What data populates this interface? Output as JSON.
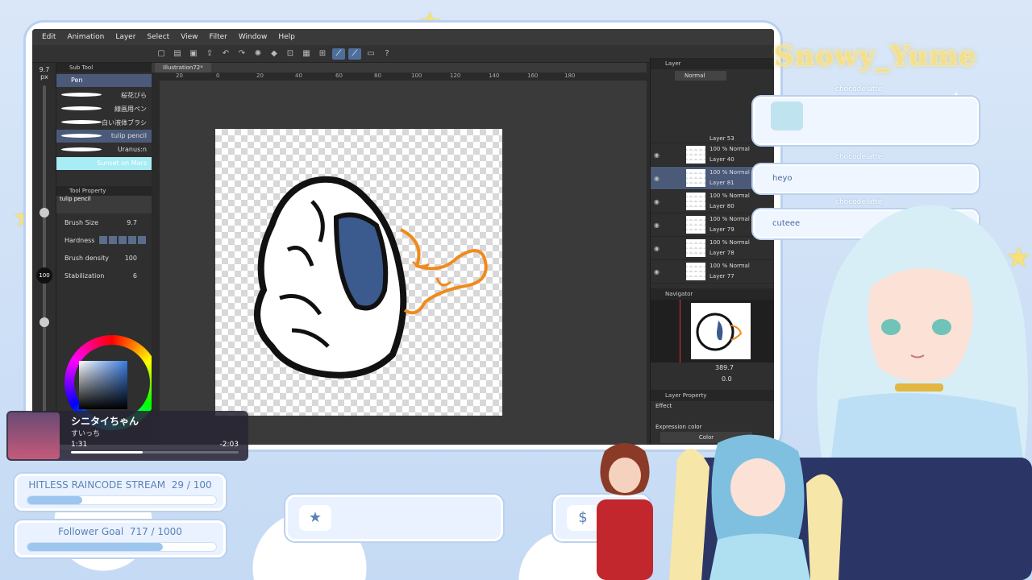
{
  "menu": [
    "Edit",
    "Animation",
    "Layer",
    "Select",
    "View",
    "Filter",
    "Window",
    "Help"
  ],
  "left_strip": {
    "brush_size_display": "9.7",
    "brush_unit": "px",
    "opacity": "100"
  },
  "subtool": {
    "header": "Sub Tool",
    "pen_label": "Pen",
    "brushes": [
      "桜花びら",
      "線画用ペン",
      "白い液体ブラシ",
      "tulip pencil",
      "Uranus:n",
      "Sunset on Mars"
    ],
    "tool_property_header": "Tool Property",
    "tool_name": "tulip pencil",
    "brush_size_label": "Brush Size",
    "brush_size_value": "9.7",
    "hardness_label": "Hardness",
    "density_label": "Brush density",
    "density_value": "100",
    "stabilization_label": "Stabilization",
    "stabilization_value": "6"
  },
  "document": {
    "tab": "Illustration72*",
    "ruler_ticks": [
      "20",
      "0",
      "20",
      "40",
      "60",
      "80",
      "100",
      "120",
      "140",
      "160",
      "180"
    ]
  },
  "layer_panel": {
    "header": "Layer",
    "blend_mode": "Normal",
    "layers": [
      {
        "opacity": "",
        "name": "Layer 53"
      },
      {
        "opacity": "100 % Normal",
        "name": "Layer 40"
      },
      {
        "opacity": "100 % Normal",
        "name": "Layer 81",
        "selected": true
      },
      {
        "opacity": "100 % Normal",
        "name": "Layer 80"
      },
      {
        "opacity": "100 % Normal",
        "name": "Layer 79"
      },
      {
        "opacity": "100 % Normal",
        "name": "Layer 78"
      },
      {
        "opacity": "100 % Normal",
        "name": "Layer 77"
      }
    ],
    "navigator_header": "Navigator",
    "zoom": "389.7",
    "rotation": "0.0",
    "layer_property_header": "Layer Property",
    "effect_label": "Effect",
    "expression_label": "Expression color",
    "expression_value": "Color"
  },
  "chat": {
    "logo": "Snowy_Yume",
    "messages": [
      {
        "user": "chocodelatte",
        "text": ""
      },
      {
        "user": "chocodelatte",
        "text": "heyo"
      },
      {
        "user": "chocodelatte",
        "text": "cuteee"
      }
    ]
  },
  "music": {
    "title": "シニタイちゃん",
    "artist": "すいっち",
    "elapsed": "1:31",
    "remaining": "-2:03",
    "progress": 0.43
  },
  "goals": [
    {
      "label": "HITLESS RAINCODE STREAM",
      "current": "29",
      "target": "100",
      "progress": 0.29
    },
    {
      "label": "Follower Goal",
      "current": "717",
      "target": "1000",
      "progress": 0.717
    }
  ],
  "colors": {
    "accent": "#4a5a78",
    "goal_fill": "#9cc6ee",
    "frame_blue": "#b9d1f0"
  }
}
